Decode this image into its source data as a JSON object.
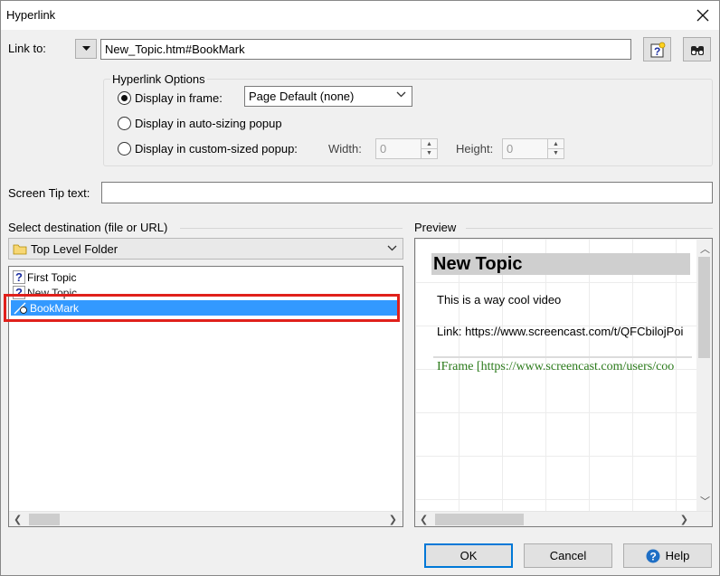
{
  "window": {
    "title": "Hyperlink"
  },
  "link_to": {
    "label": "Link to:",
    "value": "New_Topic.htm#BookMark"
  },
  "options": {
    "group_label": "Hyperlink Options",
    "display_in_frame": "Display in frame:",
    "frame_value": "Page Default (none)",
    "auto_sizing": "Display in auto-sizing popup",
    "custom_sized": "Display in custom-sized popup:",
    "width_label": "Width:",
    "width_value": "0",
    "height_label": "Height:",
    "height_value": "0"
  },
  "screen_tip": {
    "label": "Screen Tip text:",
    "value": ""
  },
  "destination": {
    "label": "Select destination (file or URL)",
    "folder": "Top Level Folder",
    "items": [
      {
        "label": "First Topic",
        "icon": "topic-icon"
      },
      {
        "label": "New Topic",
        "icon": "topic-icon"
      },
      {
        "label": "BookMark",
        "icon": "bookmark-icon",
        "selected": true
      }
    ]
  },
  "preview": {
    "label": "Preview",
    "heading": "New Topic",
    "line1": "This is a way cool video",
    "line2": "Link: https://www.screencast.com/t/QFCbilojPoi",
    "line3": "IFrame [https://www.screencast.com/users/coo"
  },
  "buttons": {
    "ok": "OK",
    "cancel": "Cancel",
    "help": "Help"
  },
  "colors": {
    "selection": "#3399ff",
    "highlight_box": "#e0201b",
    "iframe_text": "#2a7a1a",
    "default_button": "#0078d7"
  }
}
